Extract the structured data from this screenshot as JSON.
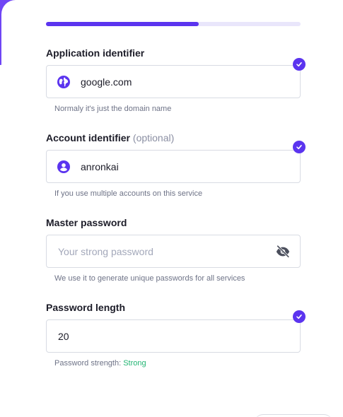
{
  "progress": {
    "fraction": 0.6
  },
  "colors": {
    "accent": "#5b34ef",
    "success": "#22b573"
  },
  "fields": {
    "app": {
      "label": "Application identifier",
      "value": "google.com",
      "icon": "globe-icon",
      "hint": "Normaly it's just the domain name",
      "valid": true
    },
    "account": {
      "label": "Account identifier",
      "optional": "(optional)",
      "value": "anronkai",
      "icon": "user-circle-icon",
      "hint": "If you use multiple accounts on this service",
      "valid": true
    },
    "master": {
      "label": "Master password",
      "placeholder": "Your strong password",
      "icon": "eye-off-icon",
      "hint": "We use it to generate unique passwords for all services"
    },
    "length": {
      "label": "Password length",
      "value": "20",
      "hint_prefix": "Password strength:",
      "strength": "Strong",
      "valid": true
    }
  }
}
